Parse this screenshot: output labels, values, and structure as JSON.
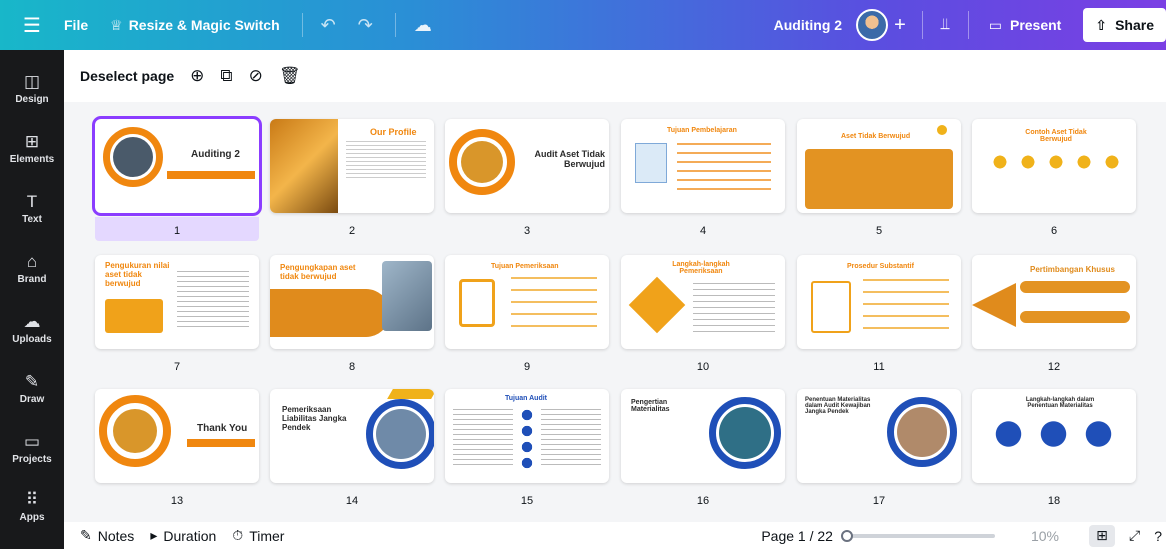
{
  "topbar": {
    "file_label": "File",
    "resize_label": "Resize & Magic Switch",
    "doc_title": "Auditing 2",
    "present_label": "Present",
    "share_label": "Share"
  },
  "rail": {
    "items": [
      {
        "label": "Design",
        "icon": "design-icon"
      },
      {
        "label": "Elements",
        "icon": "elements-icon"
      },
      {
        "label": "Text",
        "icon": "text-icon"
      },
      {
        "label": "Brand",
        "icon": "brand-icon"
      },
      {
        "label": "Uploads",
        "icon": "uploads-icon"
      },
      {
        "label": "Draw",
        "icon": "draw-icon"
      },
      {
        "label": "Projects",
        "icon": "projects-icon"
      },
      {
        "label": "Apps",
        "icon": "apps-icon"
      }
    ]
  },
  "toolbar": {
    "deselect_label": "Deselect page"
  },
  "slides": [
    {
      "number": "1",
      "title": "Auditing 2"
    },
    {
      "number": "2",
      "title": "Our Profile"
    },
    {
      "number": "3",
      "title": "Audit Aset Tidak Berwujud"
    },
    {
      "number": "4",
      "title": "Tujuan Pembelajaran"
    },
    {
      "number": "5",
      "title": "Aset Tidak Berwujud"
    },
    {
      "number": "6",
      "title": "Contoh Aset Tidak Berwujud"
    },
    {
      "number": "7",
      "title": "Pengukuran nilai aset tidak berwujud"
    },
    {
      "number": "8",
      "title": "Pengungkapan aset tidak berwujud"
    },
    {
      "number": "9",
      "title": "Tujuan Pemeriksaan"
    },
    {
      "number": "10",
      "title": "Langkah-langkah Pemeriksaan"
    },
    {
      "number": "11",
      "title": "Prosedur Substantif"
    },
    {
      "number": "12",
      "title": "Pertimbangan Khusus"
    },
    {
      "number": "13",
      "title": "Thank You"
    },
    {
      "number": "14",
      "title": "Pemeriksaan Liabilitas Jangka Pendek"
    },
    {
      "number": "15",
      "title": "Tujuan Audit"
    },
    {
      "number": "16",
      "title": "Pengertian Materialitas"
    },
    {
      "number": "17",
      "title": "Penentuan Materialitas dalam Audit Kewajiban Jangka Pendek"
    },
    {
      "number": "18",
      "title": "Langkah-langkah dalam Penentuan Materialitas"
    }
  ],
  "bottombar": {
    "notes_label": "Notes",
    "duration_label": "Duration",
    "timer_label": "Timer",
    "page_indicator": "Page 1 / 22",
    "zoom_level": "10%"
  },
  "colors": {
    "accent": "#8b3dff",
    "slide_orange": "#f0870f",
    "slide_blue": "#1f4fb8"
  }
}
